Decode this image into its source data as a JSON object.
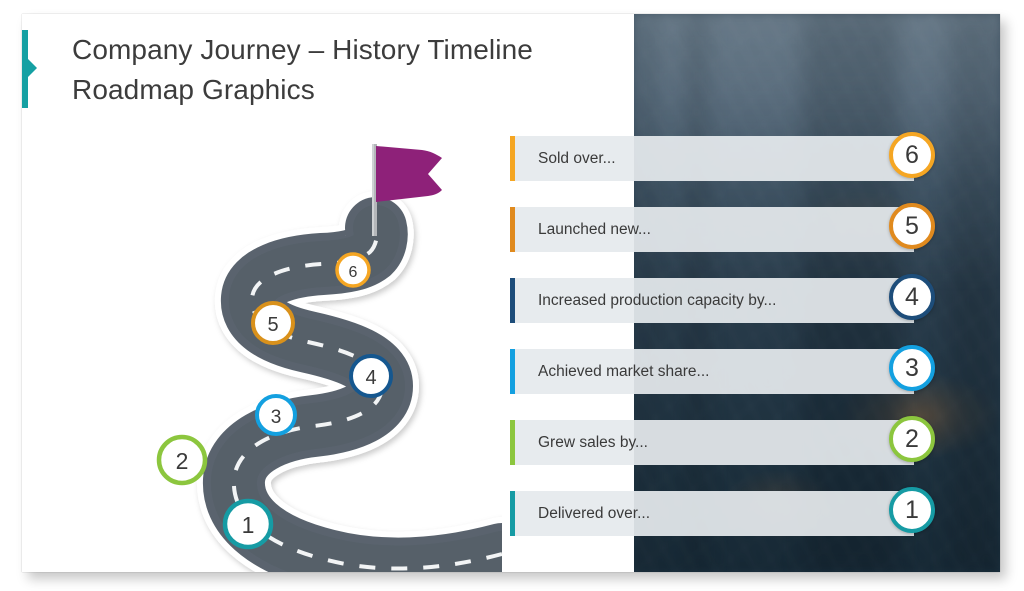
{
  "slide": {
    "title": "Company Journey – History Timeline\nRoadmap Graphics",
    "accent_color": "#15a0a3",
    "background_photo": "blurred-city-skyline-dusk"
  },
  "roadmap": {
    "flag_color": "#8e2179",
    "road_color": "#5a646e",
    "markers": [
      {
        "number": "1",
        "color": "#169ba4"
      },
      {
        "number": "2",
        "color": "#8cc63e"
      },
      {
        "number": "3",
        "color": "#13a0e0"
      },
      {
        "number": "4",
        "color": "#15578f"
      },
      {
        "number": "5",
        "color": "#d9911b"
      },
      {
        "number": "6",
        "color": "#f5a623"
      }
    ]
  },
  "list": {
    "items": [
      {
        "number": "6",
        "label": "Sold over...",
        "color": "#f5a623"
      },
      {
        "number": "5",
        "label": "Launched new...",
        "color": "#e08a1e"
      },
      {
        "number": "4",
        "label": "Increased production capacity by...",
        "color": "#1d4d7a"
      },
      {
        "number": "3",
        "label": "Achieved market share...",
        "color": "#13a0e0"
      },
      {
        "number": "2",
        "label": "Grew sales by...",
        "color": "#8cc63e"
      },
      {
        "number": "1",
        "label": "Delivered over...",
        "color": "#169ba4"
      }
    ]
  }
}
